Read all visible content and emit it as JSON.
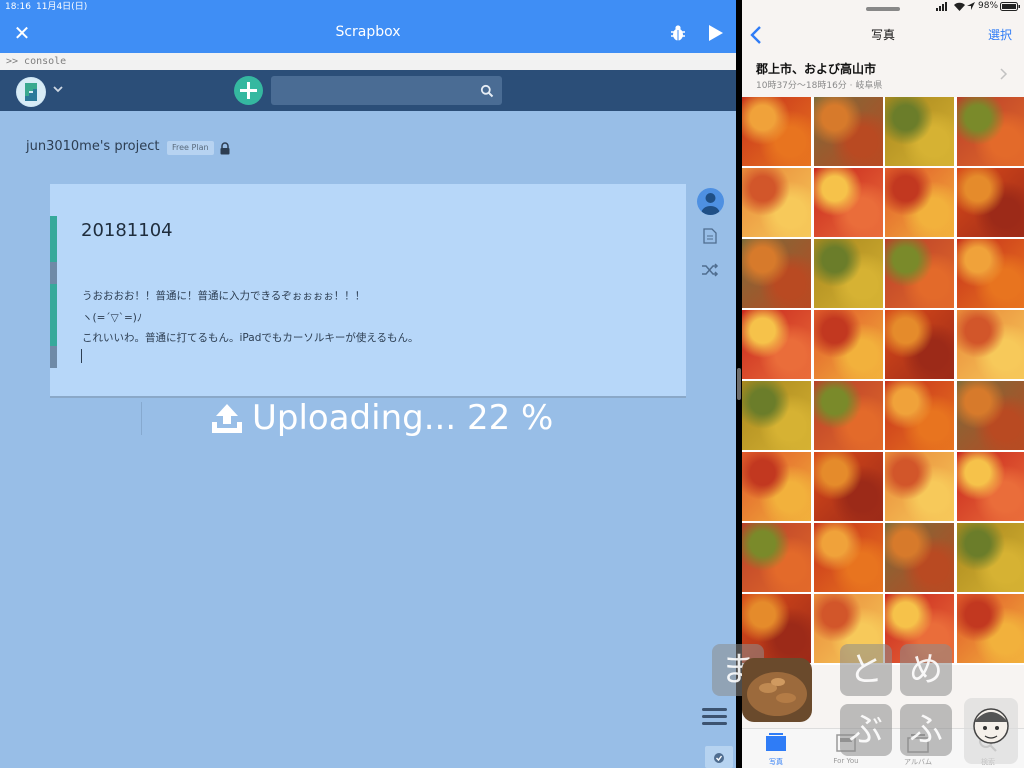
{
  "status_left": {
    "time": "18:16",
    "date": "11月4日(日)"
  },
  "scrapbox": {
    "title": "Scrapbox",
    "console": ">> console",
    "project": {
      "name": "jun3010me's project",
      "plan": "Free Plan"
    },
    "page": {
      "title": "20181104",
      "lines": [
        "うおおおお！！普通に！普通に入力できるぞぉぉぉぉ！！！",
        "ヽ(=´▽`=)ﾉ",
        "これいいわ。普通に打てるもん。iPadでもカーソルキーが使えるもん。"
      ]
    },
    "upload": {
      "label": "Uploading... 22 %",
      "progress_percent": 22
    },
    "colors": {
      "header": "#3f8ef5",
      "nav": "#2b4e78",
      "background": "#98bee7",
      "card": "#b7d7f9",
      "accent_teal": "#35b8a0"
    },
    "icons": [
      "close-icon",
      "bug-icon",
      "play-icon",
      "logo-icon",
      "chevron-down-icon",
      "add-icon",
      "search-icon",
      "lock-icon",
      "avatar-icon",
      "document-icon",
      "shuffle-icon",
      "upload-icon",
      "menu-icon",
      "check-icon"
    ]
  },
  "status_right": {
    "battery": "98%"
  },
  "photos": {
    "title": "写真",
    "select_label": "選択",
    "location": {
      "title": "郡上市、および高山市",
      "subtitle": "10時37分〜18時16分 · 岐阜県"
    },
    "tabs": [
      {
        "label": "写真",
        "active": true
      },
      {
        "label": "For You",
        "active": false
      },
      {
        "label": "アルバム",
        "active": false
      },
      {
        "label": "検索",
        "active": false
      }
    ],
    "colors": {
      "tint": "#2f7cf6"
    }
  },
  "watermark": {
    "chars": [
      "ま",
      "と",
      "め",
      "ぶ",
      "ふ"
    ]
  }
}
